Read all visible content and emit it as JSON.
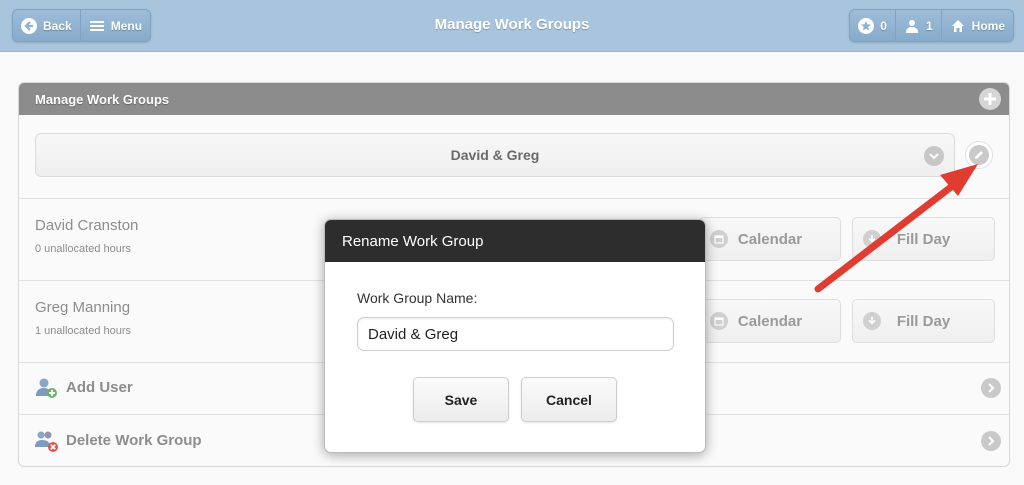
{
  "header": {
    "title": "Manage Work Groups",
    "back_label": "Back",
    "menu_label": "Menu",
    "star_count": "0",
    "user_count": "1",
    "home_label": "Home"
  },
  "panel": {
    "title": "Manage Work Groups",
    "selected_group": "David & Greg",
    "users": [
      {
        "name": "David Cranston",
        "hours": "0 unallocated hours",
        "calendar_label": "Calendar",
        "fill_label": "Fill Day"
      },
      {
        "name": "Greg Manning",
        "hours": "1 unallocated hours",
        "calendar_label": "Calendar",
        "fill_label": "Fill Day"
      }
    ],
    "add_user_label": "Add User",
    "delete_group_label": "Delete Work Group"
  },
  "modal": {
    "title": "Rename Work Group",
    "field_label": "Work Group Name:",
    "field_value": "David & Greg",
    "save_label": "Save",
    "cancel_label": "Cancel"
  },
  "colors": {
    "header_bg": "#a9c5de",
    "arrow": "#e03c31",
    "modal_head": "#2d2d2d"
  },
  "icons": [
    "back-icon",
    "menu-icon",
    "star-icon",
    "user-icon",
    "home-icon",
    "plus-icon",
    "chevron-down-icon",
    "pencil-icon",
    "calendar-icon",
    "download-icon",
    "add-user-icon",
    "delete-group-icon",
    "chevron-right-icon"
  ]
}
